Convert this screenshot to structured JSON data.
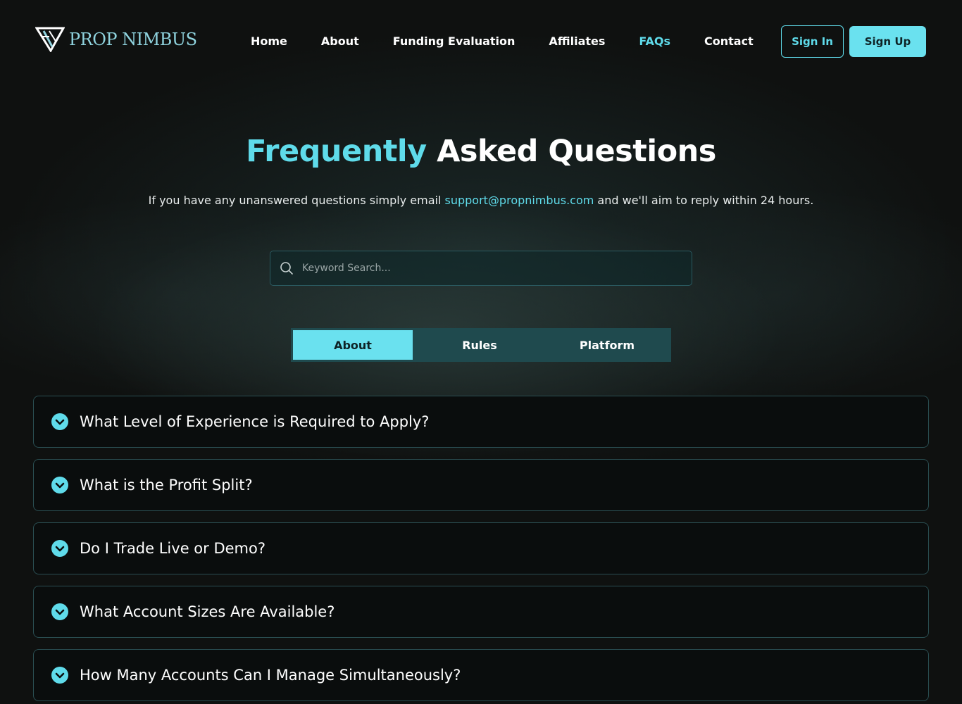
{
  "brand": {
    "name": "PROP NIMBUS",
    "accent": "#5fdbea"
  },
  "nav": {
    "items": [
      {
        "label": "Home",
        "active": false
      },
      {
        "label": "About",
        "active": false
      },
      {
        "label": "Funding Evaluation",
        "active": false
      },
      {
        "label": "Affiliates",
        "active": false
      },
      {
        "label": "FAQs",
        "active": true
      },
      {
        "label": "Contact",
        "active": false
      }
    ],
    "sign_in": "Sign In",
    "sign_up": "Sign Up"
  },
  "hero": {
    "title_accent": "Frequently",
    "title_rest": " Asked Questions",
    "subtitle_before": "If you have any unanswered questions simply email ",
    "email": "support@propnimbus.com",
    "subtitle_after": " and we'll aim to reply within 24 hours."
  },
  "search": {
    "placeholder": "Keyword Search...",
    "value": ""
  },
  "tabs": [
    {
      "label": "About",
      "active": true
    },
    {
      "label": "Rules",
      "active": false
    },
    {
      "label": "Platform",
      "active": false
    }
  ],
  "faqs": [
    {
      "question": "What Level of Experience is Required to Apply?"
    },
    {
      "question": "What is the Profit Split?"
    },
    {
      "question": "Do I Trade Live or Demo?"
    },
    {
      "question": "What Account Sizes Are Available?"
    },
    {
      "question": "How Many Accounts Can I Manage Simultaneously?"
    }
  ],
  "icons": {
    "logo": "prop-nimbus-logo-icon",
    "search": "search-icon",
    "faq_toggle": "chevron-down-circle-icon"
  }
}
